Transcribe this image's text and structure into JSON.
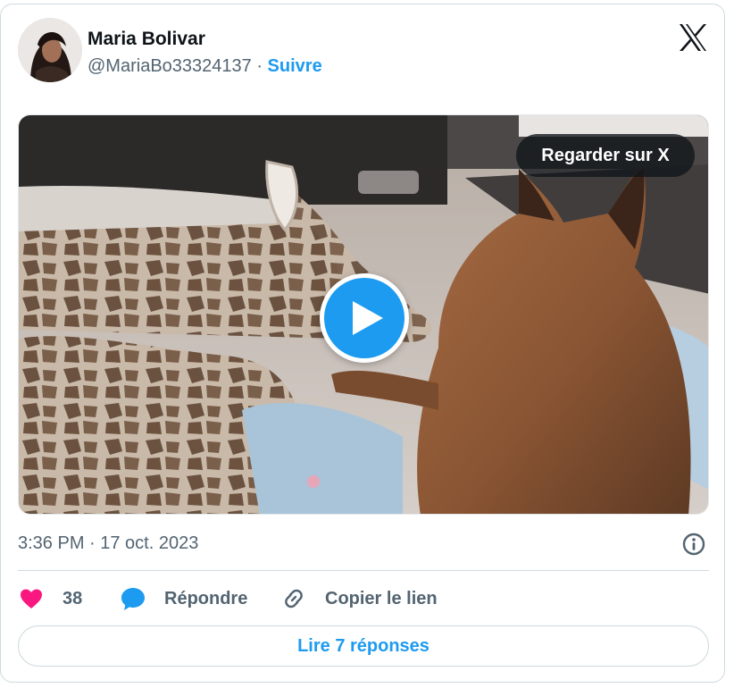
{
  "author": {
    "name": "Maria Bolivar",
    "handle": "@MariaBo33324137",
    "separator": " · ",
    "follow_label": "Suivre"
  },
  "media": {
    "watch_label": "Regarder sur X"
  },
  "meta": {
    "timestamp": "3:36 PM · 17 oct. 2023"
  },
  "actions": {
    "like_count": "38",
    "reply_label": "Répondre",
    "copy_link_label": "Copier le lien"
  },
  "footer": {
    "read_replies_label": "Lire 7 réponses"
  },
  "colors": {
    "accent": "#1d9bf0",
    "like": "#f91880",
    "secondary_text": "#536471"
  },
  "icons": [
    "x-logo-icon",
    "play-icon",
    "info-icon",
    "heart-icon",
    "reply-bubble-icon",
    "link-icon"
  ]
}
